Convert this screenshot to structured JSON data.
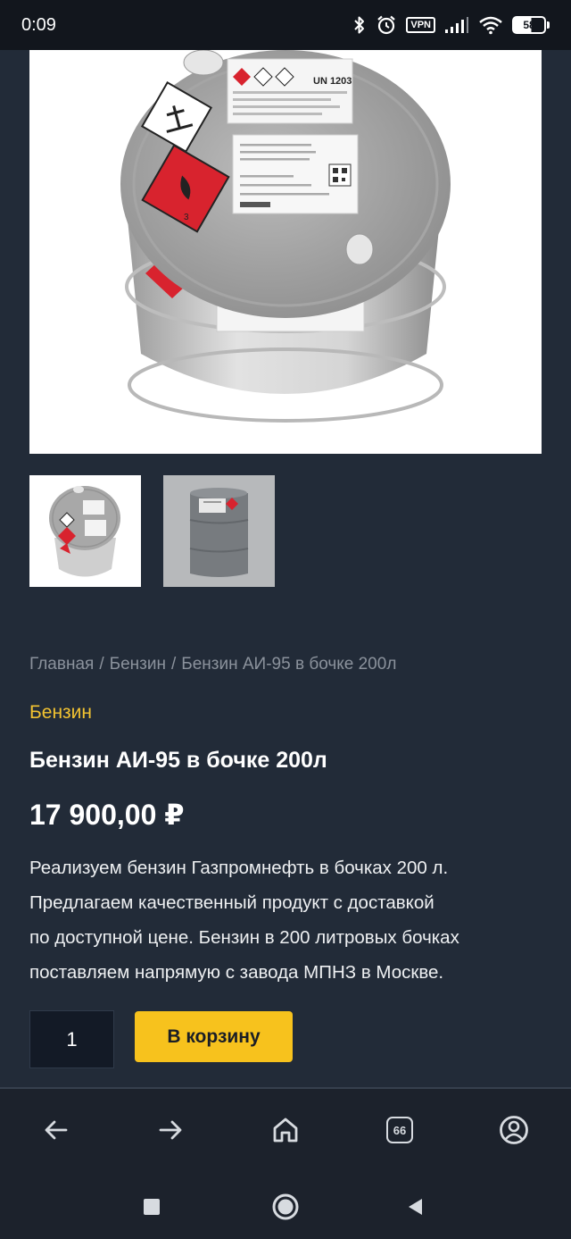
{
  "status_bar": {
    "time": "0:09",
    "vpn_label": "VPN",
    "battery": "58",
    "icons": [
      "bluetooth-icon",
      "alarm-icon",
      "vpn-icon",
      "signal-icon",
      "wifi-icon",
      "battery-icon"
    ]
  },
  "gallery": {
    "main_image": "fuel-drum-top-view",
    "thumbnails": [
      "fuel-drum-top-view",
      "fuel-drum-side-view"
    ],
    "drum_label": {
      "un_code": "UN 1203",
      "hazard_class": "3"
    }
  },
  "breadcrumb": {
    "home": "Главная",
    "separator": "/",
    "category": "Бензин",
    "current": "Бензин АИ-95 в бочке 200л"
  },
  "product": {
    "category": "Бензин",
    "title": "Бензин АИ-95 в бочке 200л",
    "price": "17 900,00 ₽",
    "description_lines": [
      "Реализуем бензин Газпромнефть в бочках 200 л.",
      "Предлагаем качественный продукт с доставкой",
      "по доступной цене. Бензин в 200 литровых бочках",
      "поставляем напрямую с завода МПНЗ в Москве."
    ],
    "quantity": "1",
    "add_to_cart_label": "В корзину"
  },
  "browser_bar": {
    "tabs_count": "66",
    "icons": [
      "back-arrow-icon",
      "forward-arrow-icon",
      "home-icon",
      "tabs-icon",
      "profile-icon"
    ]
  },
  "system_nav": {
    "icons": [
      "recent-apps-icon",
      "home-circle-icon",
      "back-triangle-icon"
    ]
  },
  "colors": {
    "background": "#222b38",
    "accent": "#f7c21d",
    "category_link": "#f3c331",
    "muted_text": "#8b929c",
    "hazard_red": "#d8232e"
  }
}
